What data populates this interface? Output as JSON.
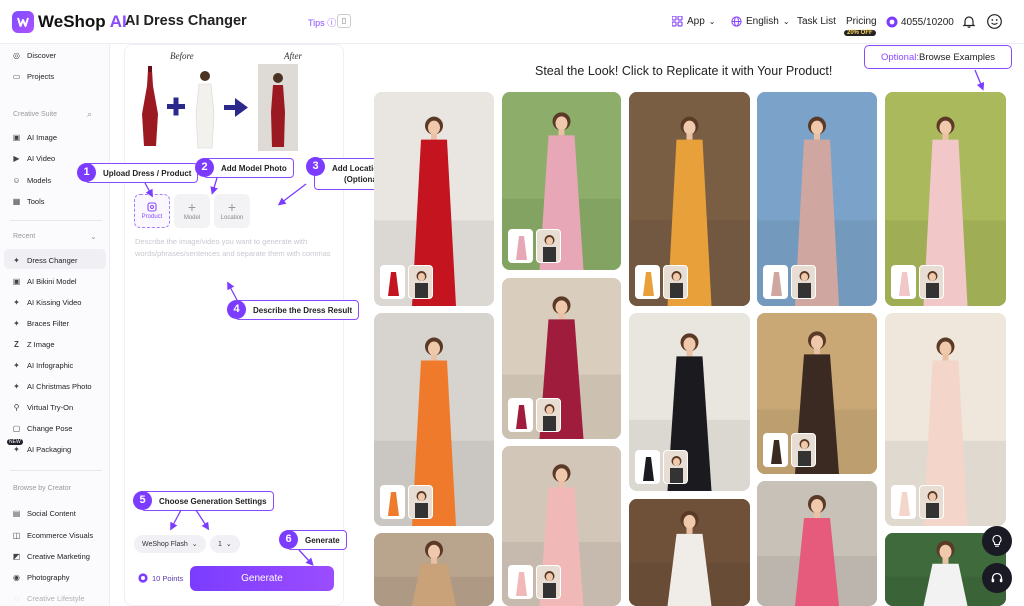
{
  "brand": {
    "name_main": "WeShop ",
    "name_ai": "AI"
  },
  "app_title": "AI Dress Changer",
  "tips": "Tips",
  "nav": {
    "app": "App",
    "language": "English",
    "task_list": "Task List",
    "pricing": "Pricing",
    "discount": "20% OFF",
    "credits": "4055/10200"
  },
  "sidebar": {
    "top": [
      "Discover",
      "Projects"
    ],
    "creative_suite_title": "Creative Suite",
    "creative": [
      "AI Image",
      "AI Video",
      "Models",
      "Tools"
    ],
    "recent_title": "Recent",
    "recent": [
      "Dress Changer",
      "AI Bikini Model",
      "AI Kissing Video",
      "Braces Filter",
      "Z Image",
      "AI Infographic",
      "AI Christmas Photo",
      "Virtual Try-On",
      "Change Pose",
      "AI Packaging"
    ],
    "new_badge": "NEW",
    "browse_title": "Browse by Creator",
    "browse": [
      "Social Content",
      "Ecommerce Visuals",
      "Creative Marketing",
      "Photography",
      "Creative Lifestyle"
    ]
  },
  "panel": {
    "before": "Before",
    "after": "After",
    "tools": [
      "Product",
      "Model",
      "Location"
    ],
    "prompt_placeholder": "Describe the image/video you want to generate with words/phrases/sentences and separate them with commas",
    "model_select": "WeShop Flash",
    "count_select": "1",
    "points": "10 Points",
    "generate": "Generate"
  },
  "callouts": [
    {
      "num": "1",
      "label": "Upload Dress / Product"
    },
    {
      "num": "2",
      "label": "Add Model Photo"
    },
    {
      "num": "3",
      "label": "Add Location",
      "label2": "(Optional)"
    },
    {
      "num": "4",
      "label": "Describe the Dress Result"
    },
    {
      "num": "5",
      "label": "Choose Generation Settings"
    },
    {
      "num": "6",
      "label": "Generate"
    }
  ],
  "main": {
    "title": "Steal the Look! Click to Replicate it with Your Product!",
    "examples_prefix": "Optional:",
    "examples_label": " Browse Examples"
  },
  "colors": {
    "accent": "#7b3cff",
    "accent_light": "#8a4bff"
  }
}
